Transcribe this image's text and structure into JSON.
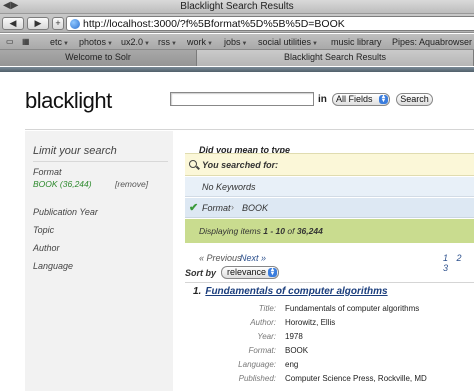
{
  "window": {
    "title": "Blacklight Search Results"
  },
  "toolbar": {
    "back": "◀",
    "forward": "▶",
    "add": "+",
    "url": "http://localhost:3000/?f%5Bformat%5D%5B%5D=BOOK"
  },
  "bookmarks": [
    "etc",
    "photos",
    "ux2.0",
    "rss",
    "work",
    "jobs",
    "social utilities",
    "music library",
    "Pipes: Aquabrowser"
  ],
  "tabs": [
    "Welcome to Solr",
    "Blacklight Search Results"
  ],
  "header": {
    "logo": "blacklight",
    "search_placeholder": "",
    "in_label": "in",
    "field_select": "All Fields",
    "search_button": "Search"
  },
  "sidebar": {
    "title": "Limit your search",
    "format_label": "Format",
    "facet_value": "BOOK (36,244)",
    "facet_remove": "[remove]",
    "items": [
      "Publication Year",
      "Topic",
      "Author",
      "Language"
    ]
  },
  "main": {
    "did_you_mean": "Did you mean to type",
    "searched_for": "You searched for:",
    "no_keywords": "No Keywords",
    "filter_label": "Format",
    "filter_value": "BOOK",
    "displaying_prefix": "Displaying items ",
    "displaying_range": "1 - 10",
    "displaying_of": " of ",
    "displaying_total": "36,244",
    "previous": "« Previous",
    "next": "Next »",
    "pages": [
      "1",
      "2",
      "3"
    ],
    "sort_label": "Sort by",
    "sort_value": "relevance"
  },
  "result": {
    "number": "1.",
    "title": "Fundamentals of computer algorithms",
    "fields": [
      {
        "label": "Title:",
        "value": "Fundamentals of computer algorithms"
      },
      {
        "label": "Author:",
        "value": "Horowitz, Ellis"
      },
      {
        "label": "Year:",
        "value": "1978"
      },
      {
        "label": "Format:",
        "value": "BOOK"
      },
      {
        "label": "Language:",
        "value": "eng"
      },
      {
        "label": "Published:",
        "value": "Computer Science Press, Rockville, MD"
      }
    ]
  },
  "colors": {
    "facet_green": "#2d8a2d",
    "link_blue": "#1a3d7c",
    "result_bar_green": "#c9dc8f",
    "query_box_yellow": "#fbf7d8"
  }
}
